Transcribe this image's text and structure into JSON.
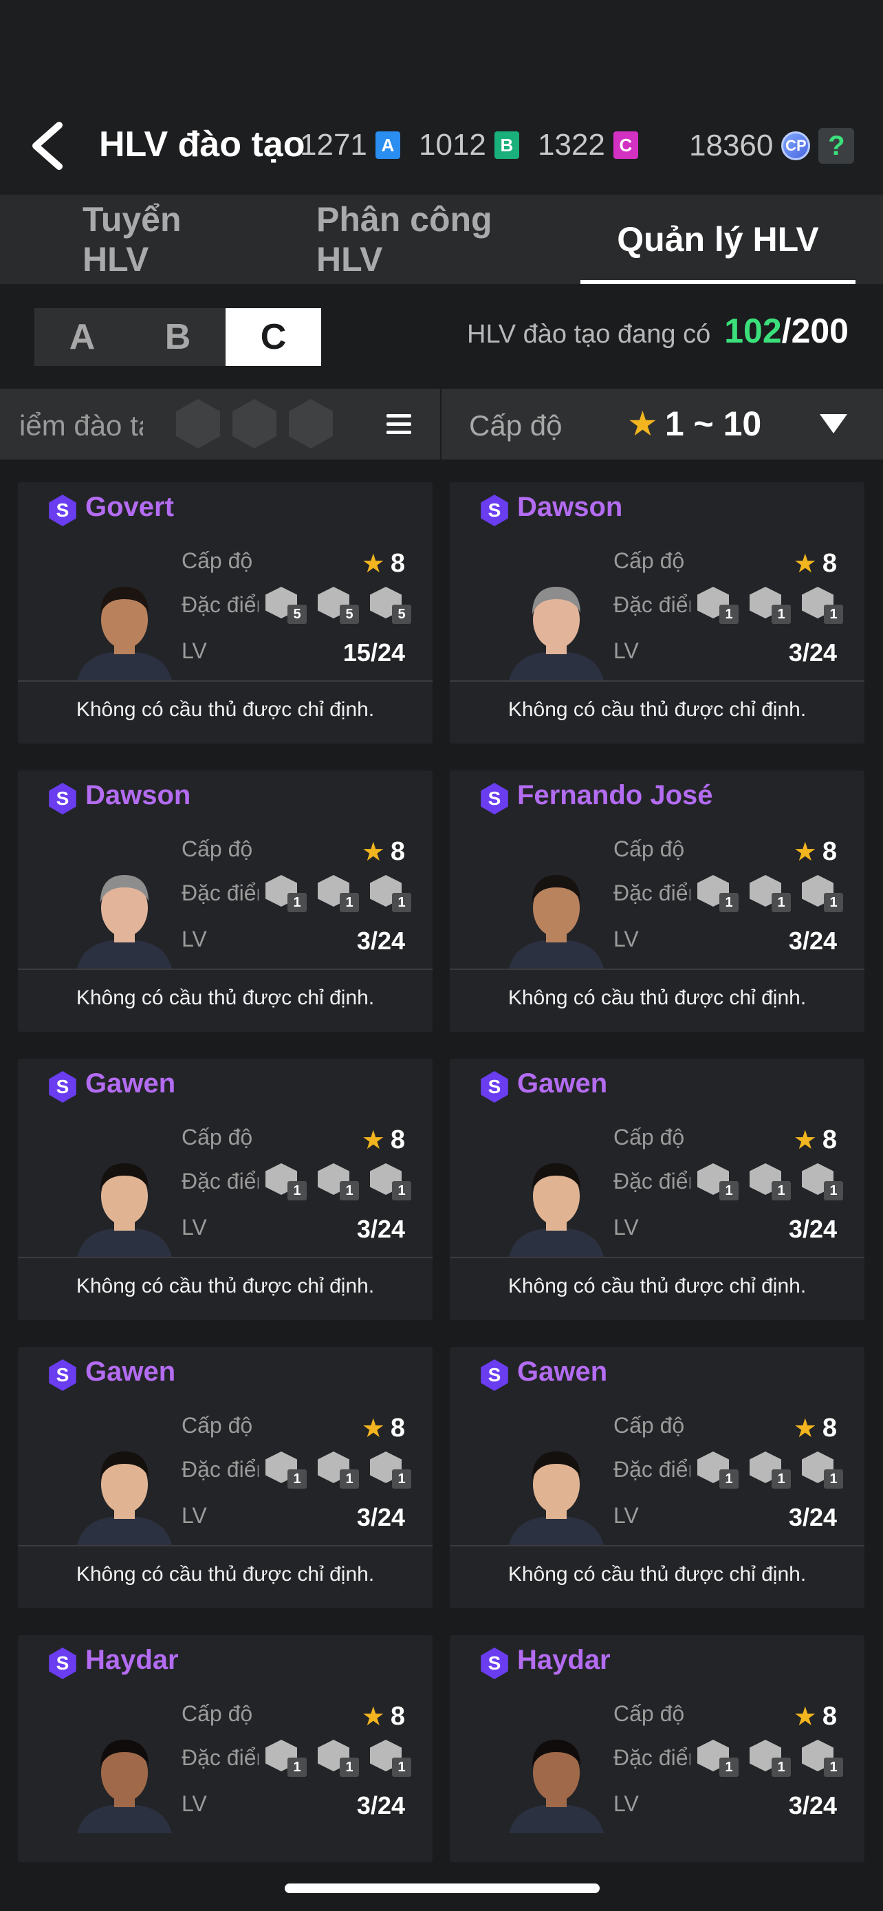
{
  "header": {
    "title": "HLV đào tạo",
    "currencies": [
      {
        "value": "1271",
        "badge": "A",
        "color": "#2a8df0"
      },
      {
        "value": "1012",
        "badge": "B",
        "color": "#19b07c"
      },
      {
        "value": "1322",
        "badge": "C",
        "color": "#d331c2"
      }
    ],
    "cp_value": "18360",
    "cp_badge": "CP",
    "help": "?"
  },
  "tabs": [
    {
      "label": "Tuyển HLV"
    },
    {
      "label": "Phân công  HLV"
    },
    {
      "label": "Quản lý HLV",
      "active": true
    }
  ],
  "grade_selector": {
    "options": [
      "A",
      "B",
      "C"
    ],
    "selected": "C"
  },
  "coach_count": {
    "label": "HLV đào tạo đang có",
    "current": "102",
    "max": "/200"
  },
  "filter": {
    "left_label": "iểm đào tạ",
    "level_label": "Cấp độ",
    "level_range": "1 ~ 10"
  },
  "card_labels": {
    "level": "Cấp độ",
    "traits": "Đặc điểm",
    "lv": "LV",
    "message": "Không có cầu thủ được chỉ định.",
    "grade": "S"
  },
  "cards": [
    {
      "name": "Govert",
      "stars": "8",
      "lv": "15/24",
      "traits": [
        "5",
        "5",
        "5"
      ],
      "skin": "#b9825d",
      "hair": "#1b1410"
    },
    {
      "name": "Dawson",
      "stars": "8",
      "lv": "3/24",
      "traits": [
        "1",
        "1",
        "1"
      ],
      "skin": "#e2b49a",
      "hair": "#8d8d8d"
    },
    {
      "name": "Dawson",
      "stars": "8",
      "lv": "3/24",
      "traits": [
        "1",
        "1",
        "1"
      ],
      "skin": "#e2b49a",
      "hair": "#8d8d8d"
    },
    {
      "name": "Fernando José",
      "stars": "8",
      "lv": "3/24",
      "traits": [
        "1",
        "1",
        "1"
      ],
      "skin": "#b9835e",
      "hair": "#161210"
    },
    {
      "name": "Gawen",
      "stars": "8",
      "lv": "3/24",
      "traits": [
        "1",
        "1",
        "1"
      ],
      "skin": "#e0b493",
      "hair": "#14100e"
    },
    {
      "name": "Gawen",
      "stars": "8",
      "lv": "3/24",
      "traits": [
        "1",
        "1",
        "1"
      ],
      "skin": "#e0b493",
      "hair": "#14100e"
    },
    {
      "name": "Gawen",
      "stars": "8",
      "lv": "3/24",
      "traits": [
        "1",
        "1",
        "1"
      ],
      "skin": "#e0b493",
      "hair": "#14100e"
    },
    {
      "name": "Gawen",
      "stars": "8",
      "lv": "3/24",
      "traits": [
        "1",
        "1",
        "1"
      ],
      "skin": "#e0b493",
      "hair": "#14100e"
    },
    {
      "name": "Haydar",
      "stars": "8",
      "lv": "3/24",
      "traits": [
        "1",
        "1",
        "1"
      ],
      "skin": "#a06a4a",
      "hair": "#0f0c0b"
    },
    {
      "name": "Haydar",
      "stars": "8",
      "lv": "3/24",
      "traits": [
        "1",
        "1",
        "1"
      ],
      "skin": "#a06a4a",
      "hair": "#0f0c0b"
    }
  ]
}
